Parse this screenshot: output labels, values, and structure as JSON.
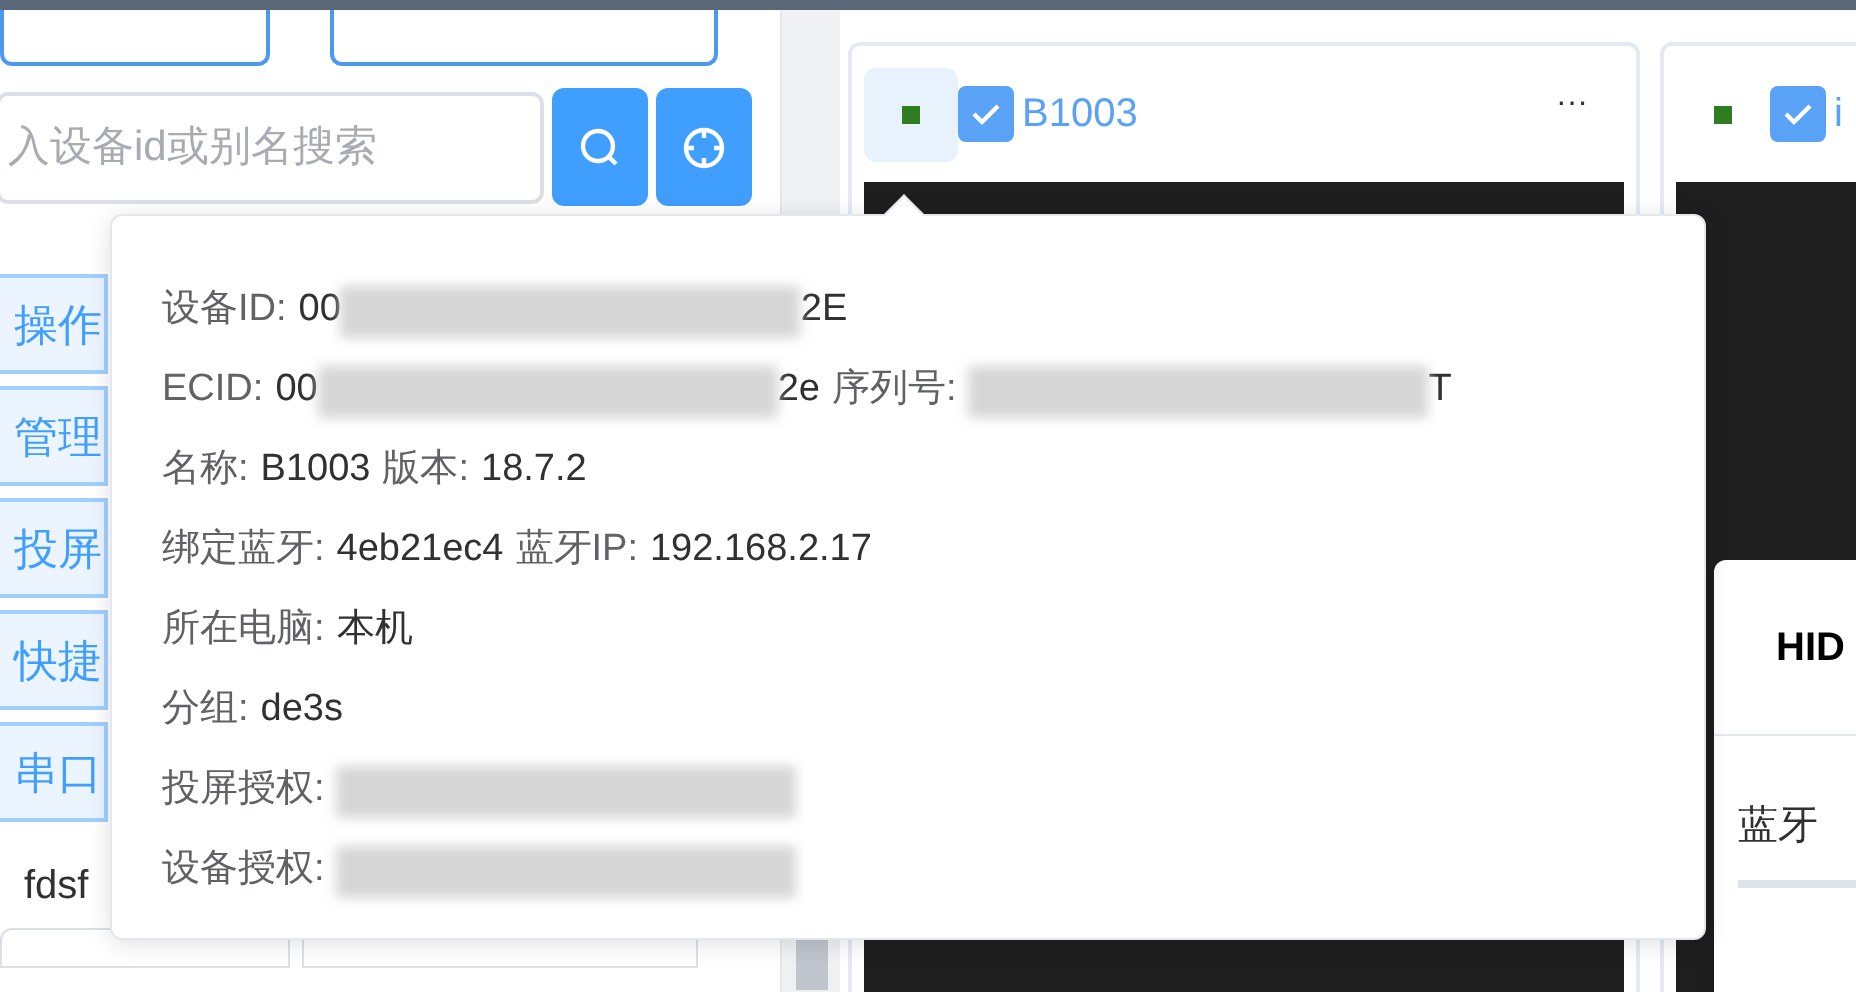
{
  "left_panel": {
    "search": {
      "placeholder": "入设备id或别名搜索"
    },
    "side_buttons": [
      "操作",
      "管理",
      "投屏",
      "快捷",
      "串口"
    ],
    "group_row": {
      "label": "fdsf"
    }
  },
  "devices": [
    {
      "name": "B1003",
      "online": true,
      "checked": true,
      "color": "#2e7d1f",
      "menu": "···"
    },
    {
      "name": "i",
      "online": true,
      "checked": true,
      "color": "#2e7d1f"
    }
  ],
  "dialog": {
    "title": "HID",
    "label": "蓝牙"
  },
  "tooltip": {
    "lines": [
      [
        {
          "label": "设备ID:",
          "value": "00",
          "redacted": true,
          "tail": "2E"
        }
      ],
      [
        {
          "label": "ECID:",
          "value": "00",
          "redacted": true,
          "tail": "2e"
        },
        {
          "label": "序列号:",
          "redacted": true,
          "tail": "T"
        }
      ],
      [
        {
          "label": "名称:",
          "value": "B1003"
        },
        {
          "label": "版本:",
          "value": "18.7.2"
        }
      ],
      [
        {
          "label": "绑定蓝牙:",
          "value": "4eb21ec4"
        },
        {
          "label": "蓝牙IP:",
          "value": "192.168.2.17"
        }
      ],
      [
        {
          "label": "所在电脑:",
          "value": "本机"
        }
      ],
      [
        {
          "label": "分组:",
          "value": "de3s"
        }
      ],
      [
        {
          "label": "投屏授权:",
          "redacted": true
        }
      ],
      [
        {
          "label": "设备授权:",
          "redacted": true
        }
      ]
    ]
  }
}
